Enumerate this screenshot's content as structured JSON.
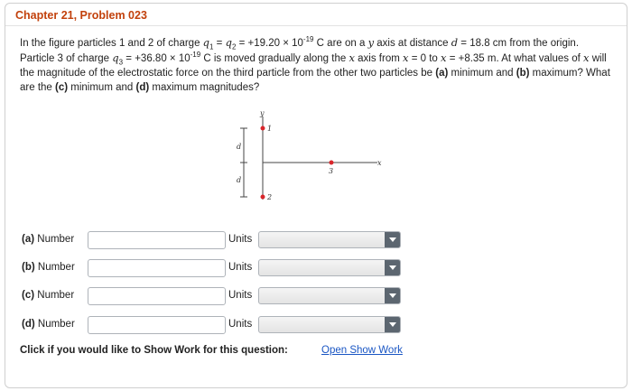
{
  "header": {
    "title": "Chapter 21, Problem 023"
  },
  "problem": {
    "line1_a": "In the figure particles 1 and 2 of charge ",
    "q1": "q",
    "q1_sub": "1",
    "eq1": " = ",
    "q2": "q",
    "q2_sub": "2",
    "line1_b": " = +19.20 × 10",
    "exp1": "-19",
    "line1_c": " C are on a ",
    "y": "y",
    "line1_d": " axis at distance ",
    "d": "d",
    "line1_e": " = 18.8 cm from the origin. Particle 3 of charge ",
    "q3": "q",
    "q3_sub": "3",
    "line1_f": " = +36.80 × 10",
    "exp2": "-19",
    "line1_g": " C is moved gradually along the ",
    "x1": "x",
    "line1_h": " axis from ",
    "x2": "x",
    "line1_i": " = 0 to ",
    "x3": "x",
    "line1_j": " = +8.35 m. At what values of ",
    "x4": "x",
    "line1_k": " will the magnitude of the electrostatic force on the third particle from the other two particles be ",
    "a": "(a)",
    "t_min": " minimum and ",
    "b": "(b)",
    "t_max": " maximum? What are the ",
    "c": "(c)",
    "t_minmag": " minimum and ",
    "dd": "(d)",
    "t_maxmag": " maximum magnitudes?"
  },
  "figure": {
    "y_label": "y",
    "x_label": "x",
    "particle1": "1",
    "particle2": "2",
    "particle3": "3",
    "d_upper": "d",
    "d_lower": "d",
    "particle_color": "#d9262b"
  },
  "answers": [
    {
      "part": "(a)",
      "label": " Number",
      "units_label": "Units",
      "value": "",
      "unit_selected": ""
    },
    {
      "part": "(b)",
      "label": " Number",
      "units_label": "Units",
      "value": "",
      "unit_selected": ""
    },
    {
      "part": "(c)",
      "label": " Number",
      "units_label": "Units",
      "value": "",
      "unit_selected": ""
    },
    {
      "part": "(d)",
      "label": " Number",
      "units_label": "Units",
      "value": "",
      "unit_selected": ""
    }
  ],
  "footer": {
    "show_work_prompt": "Click if you would like to Show Work for this question:",
    "show_work_link": "Open Show Work"
  }
}
